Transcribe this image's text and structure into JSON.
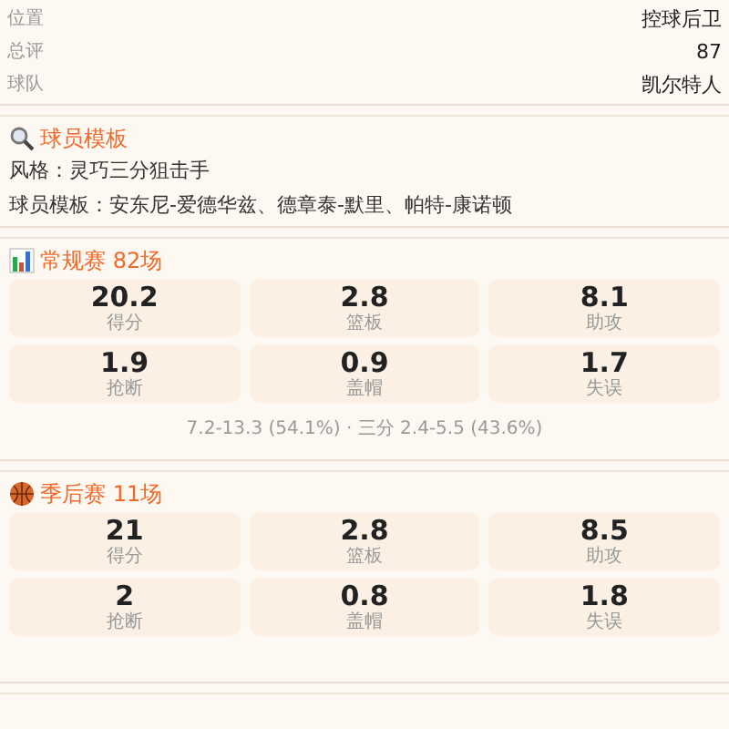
{
  "info_rows": [
    {
      "label": "位置",
      "value": "控球后卫"
    },
    {
      "label": "总评",
      "value": "87"
    },
    {
      "label": "球队",
      "value": "凯尔特人"
    }
  ],
  "template": {
    "title": "球员模板",
    "lines": [
      "风格：灵巧三分狙击手",
      "球员模板：安东尼-爱德华兹、德章泰-默里、帕特-康诺顿"
    ]
  },
  "stat_sections": [
    {
      "kind": "chart",
      "title": "常规赛 82场",
      "stats": [
        {
          "value": "20.2",
          "label": "得分"
        },
        {
          "value": "2.8",
          "label": "篮板"
        },
        {
          "value": "8.1",
          "label": "助攻"
        },
        {
          "value": "1.9",
          "label": "抢断"
        },
        {
          "value": "0.9",
          "label": "盖帽"
        },
        {
          "value": "1.7",
          "label": "失误"
        }
      ],
      "footnote": "7.2-13.3 (54.1%) · 三分 2.4-5.5 (43.6%)"
    },
    {
      "kind": "ball",
      "title": "季后赛 11场",
      "stats": [
        {
          "value": "21",
          "label": "得分"
        },
        {
          "value": "2.8",
          "label": "篮板"
        },
        {
          "value": "8.5",
          "label": "助攻"
        },
        {
          "value": "2",
          "label": "抢断"
        },
        {
          "value": "0.8",
          "label": "盖帽"
        },
        {
          "value": "1.8",
          "label": "失误"
        }
      ]
    }
  ]
}
